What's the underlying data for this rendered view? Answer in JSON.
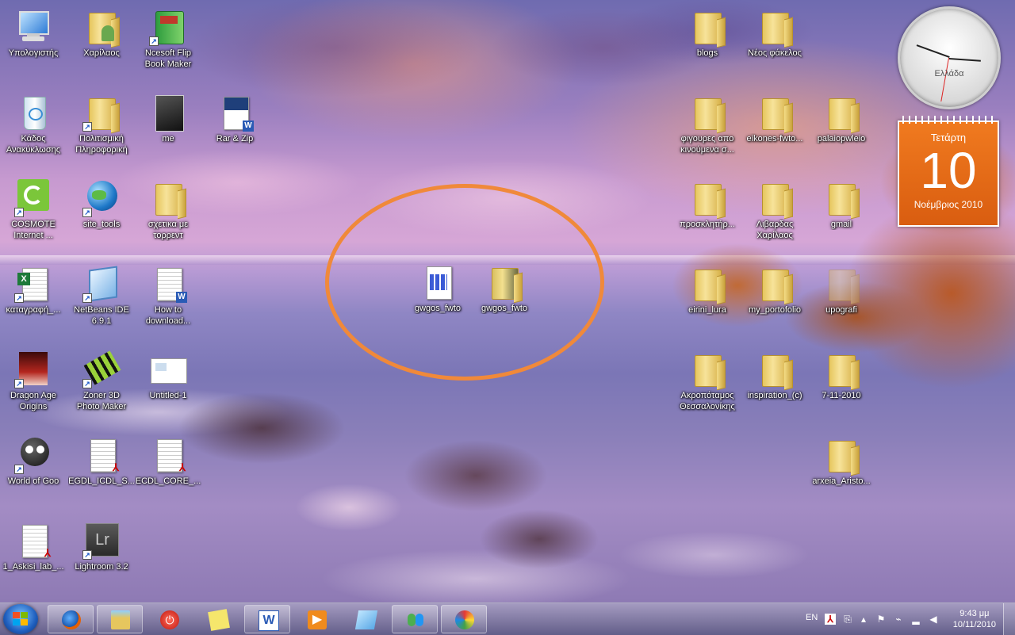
{
  "desktop": {
    "icons": [
      {
        "label": "Υπολογιστής"
      },
      {
        "label": "Χαρίλαος"
      },
      {
        "label": "Ncesoft Flip\nBook Maker"
      },
      {
        "label": "Κάδος\nΑνακύκλωσης"
      },
      {
        "label": "Πολιτισμική\nΠληροφορική"
      },
      {
        "label": "me"
      },
      {
        "label": "Rar & Zip"
      },
      {
        "label": "COSMOTE\nInternet ..."
      },
      {
        "label": "site_tools"
      },
      {
        "label": "σχετικα με\nτορρεντ"
      },
      {
        "label": "καταγραφή_..."
      },
      {
        "label": "NetBeans IDE\n6.9.1"
      },
      {
        "label": "How to\ndownload..."
      },
      {
        "label": "Dragon Age\nOrigins"
      },
      {
        "label": "Zoner 3D\nPhoto Maker"
      },
      {
        "label": "Untitled-1"
      },
      {
        "label": "World of Goo"
      },
      {
        "label": "EGDL_ICDL_S..."
      },
      {
        "label": "ECDL_CORE_..."
      },
      {
        "label": "1_Askisi_lab_..."
      },
      {
        "label": "Lightroom 3.2"
      },
      {
        "label": "gwgos_fwto"
      },
      {
        "label": "gwgos_fwto"
      },
      {
        "label": "blogs"
      },
      {
        "label": "Νέος φάκελος"
      },
      {
        "label": "φιγουρες απο\nκινούμενα σ..."
      },
      {
        "label": "eikones-fwto..."
      },
      {
        "label": "palaiopwleio"
      },
      {
        "label": "προσκλητήρ..."
      },
      {
        "label": "Λιβαρδας\nΧαρίλαος"
      },
      {
        "label": "gmail"
      },
      {
        "label": "eirini_lura"
      },
      {
        "label": "my_portofolio"
      },
      {
        "label": "upografi"
      },
      {
        "label": "Ακροπόταμος\nΘεσσαλονίκης"
      },
      {
        "label": "inspiration_(c)"
      },
      {
        "label": "7-11-2010"
      },
      {
        "label": "arxeia_Aristo..."
      }
    ]
  },
  "gadgets": {
    "clock": {
      "label": "Ελλάδα"
    },
    "calendar": {
      "weekday": "Τετάρτη",
      "day": "10",
      "month_year": "Νοέμβριος 2010"
    }
  },
  "taskbar": {
    "pinned": [
      "firefox-icon",
      "explorer-icon",
      "power-icon",
      "sticky-notes-icon",
      "word-icon",
      "media-player-icon",
      "notepad-icon",
      "messenger-icon",
      "paint-icon"
    ],
    "tray": {
      "language": "EN",
      "time": "9:43 μμ",
      "date": "10/11/2010"
    }
  },
  "colors": {
    "highlight": "#f0893a",
    "calendar": "#e86a18"
  }
}
